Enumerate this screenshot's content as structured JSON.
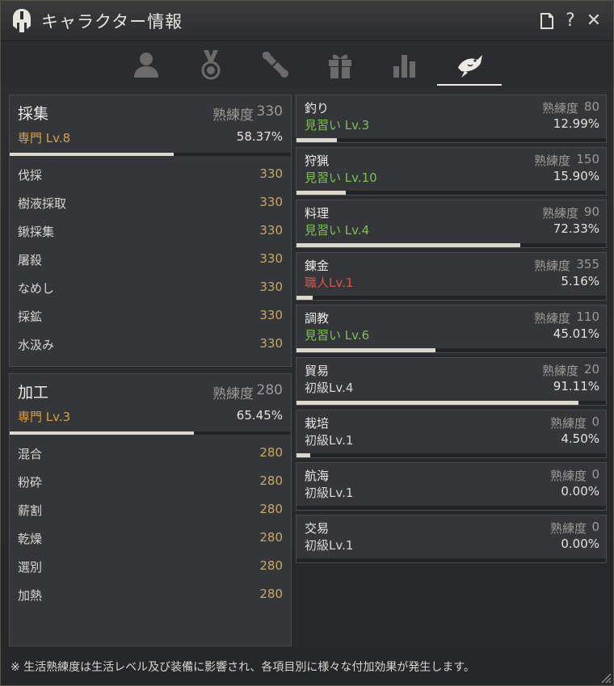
{
  "window": {
    "title": "キャラクター情報",
    "buttons": {
      "note": "🗋",
      "help": "?",
      "close": "✕"
    }
  },
  "tabs": [
    {
      "icon": "person-icon",
      "active": false
    },
    {
      "icon": "medal-icon",
      "active": false
    },
    {
      "icon": "scroll-icon",
      "active": false
    },
    {
      "icon": "gift-icon",
      "active": false
    },
    {
      "icon": "bar-chart-icon",
      "active": false
    },
    {
      "icon": "fish-icon",
      "active": true
    }
  ],
  "left_panels": [
    {
      "title": "採集",
      "mastery_label": "熟練度",
      "mastery_value": "330",
      "level": "専門 Lv.8",
      "percent": "58.37%",
      "progress": 0.5837,
      "rows": [
        {
          "name": "伐採",
          "value": "330"
        },
        {
          "name": "樹液採取",
          "value": "330"
        },
        {
          "name": "鍬採集",
          "value": "330"
        },
        {
          "name": "屠殺",
          "value": "330"
        },
        {
          "name": "なめし",
          "value": "330"
        },
        {
          "name": "採鉱",
          "value": "330"
        },
        {
          "name": "水汲み",
          "value": "330"
        }
      ]
    },
    {
      "title": "加工",
      "mastery_label": "熟練度",
      "mastery_value": "280",
      "level": "専門 Lv.3",
      "percent": "65.45%",
      "progress": 0.6545,
      "rows": [
        {
          "name": "混合",
          "value": "280"
        },
        {
          "name": "粉砕",
          "value": "280"
        },
        {
          "name": "薪割",
          "value": "280"
        },
        {
          "name": "乾燥",
          "value": "280"
        },
        {
          "name": "選別",
          "value": "280"
        },
        {
          "name": "加熱",
          "value": "280"
        }
      ]
    }
  ],
  "right_cards": [
    {
      "name": "釣り",
      "mastery_label": "熟練度",
      "mastery_value": "80",
      "level": "見習い Lv.3",
      "level_color": "#7fbf5a",
      "percent": "12.99%",
      "progress": 0.1299
    },
    {
      "name": "狩猟",
      "mastery_label": "熟練度",
      "mastery_value": "150",
      "level": "見習い Lv.10",
      "level_color": "#7fbf5a",
      "percent": "15.90%",
      "progress": 0.159
    },
    {
      "name": "料理",
      "mastery_label": "熟練度",
      "mastery_value": "90",
      "level": "見習い Lv.4",
      "level_color": "#7fbf5a",
      "percent": "72.33%",
      "progress": 0.7233
    },
    {
      "name": "錬金",
      "mastery_label": "熟練度",
      "mastery_value": "355",
      "level": "職人Lv.1",
      "level_color": "#d9534a",
      "percent": "5.16%",
      "progress": 0.0516
    },
    {
      "name": "調教",
      "mastery_label": "熟練度",
      "mastery_value": "110",
      "level": "見習い Lv.6",
      "level_color": "#7fbf5a",
      "percent": "45.01%",
      "progress": 0.4501
    },
    {
      "name": "貿易",
      "mastery_label": "熟練度",
      "mastery_value": "20",
      "level": "初級Lv.4",
      "level_color": "#d8d6d0",
      "percent": "91.11%",
      "progress": 0.9111
    },
    {
      "name": "栽培",
      "mastery_label": "熟練度",
      "mastery_value": "0",
      "level": "初級Lv.1",
      "level_color": "#d8d6d0",
      "percent": "4.50%",
      "progress": 0.045
    },
    {
      "name": "航海",
      "mastery_label": "熟練度",
      "mastery_value": "0",
      "level": "初級Lv.1",
      "level_color": "#d8d6d0",
      "percent": "0.00%",
      "progress": 0.0
    },
    {
      "name": "交易",
      "mastery_label": "熟練度",
      "mastery_value": "0",
      "level": "初級Lv.1",
      "level_color": "#d8d6d0",
      "percent": "0.00%",
      "progress": 0.0
    }
  ],
  "footer": {
    "note": "※ 生活熟練度は生活レベル及び装備に影響され、各項目別に様々な付加効果が発生します。"
  }
}
